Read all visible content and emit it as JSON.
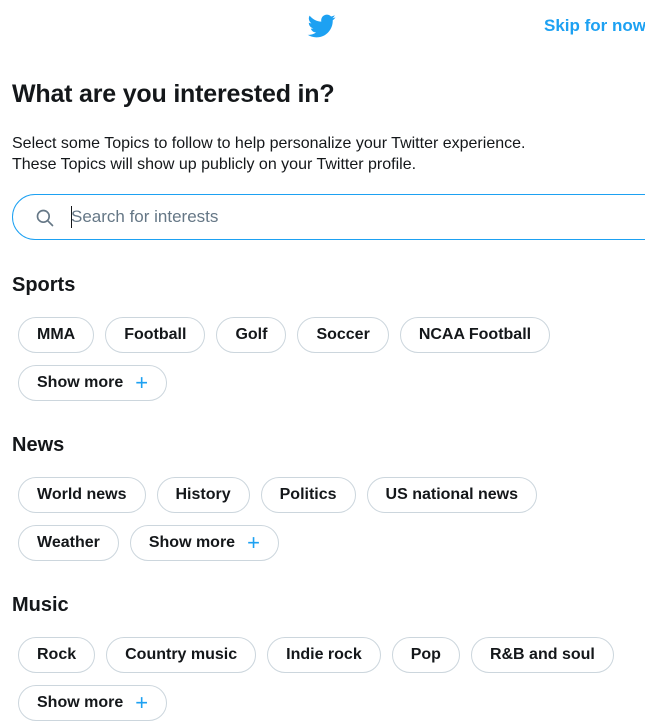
{
  "header": {
    "skip_label": "Skip for now",
    "logo_icon": "twitter-bird-icon"
  },
  "page": {
    "title": "What are you interested in?",
    "description_line1": "Select some Topics to follow to help personalize your Twitter experience.",
    "description_line2": "These Topics will show up publicly on your Twitter profile."
  },
  "search": {
    "placeholder": "Search for interests",
    "value": "",
    "icon": "search-icon"
  },
  "sections": [
    {
      "title": "Sports",
      "topics": [
        "MMA",
        "Football",
        "Golf",
        "Soccer",
        "NCAA Football"
      ],
      "show_more_label": "Show more"
    },
    {
      "title": "News",
      "topics": [
        "World news",
        "History",
        "Politics",
        "US national news",
        "Weather"
      ],
      "show_more_label": "Show more"
    },
    {
      "title": "Music",
      "topics": [
        "Rock",
        "Country music",
        "Indie rock",
        "Pop",
        "R&B and soul"
      ],
      "show_more_label": "Show more"
    }
  ],
  "colors": {
    "accent": "#1da1f2",
    "text": "#14171a",
    "chip_border": "#ccd6dd",
    "secondary_text": "#657786"
  }
}
